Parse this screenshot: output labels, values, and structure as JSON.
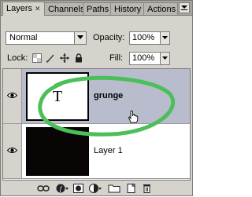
{
  "tabs": [
    {
      "label": "Layers",
      "active": true
    },
    {
      "label": "Channels",
      "active": false
    },
    {
      "label": "Paths",
      "active": false
    },
    {
      "label": "History",
      "active": false
    },
    {
      "label": "Actions",
      "active": false
    }
  ],
  "blend": {
    "mode": "Normal"
  },
  "opacity": {
    "label": "Opacity:",
    "value": "100%"
  },
  "lock": {
    "label": "Lock:"
  },
  "fill": {
    "label": "Fill:",
    "value": "100%"
  },
  "layers": [
    {
      "name": "grunge",
      "thumb_text": "T",
      "selected": true,
      "visible": true
    },
    {
      "name": "Layer 1",
      "thumb_text": "",
      "selected": false,
      "visible": true
    }
  ],
  "annotation": {
    "color": "#4cbf5a"
  },
  "colors": {
    "selection": "#b8bccc",
    "panel": "#d6d3cc"
  }
}
